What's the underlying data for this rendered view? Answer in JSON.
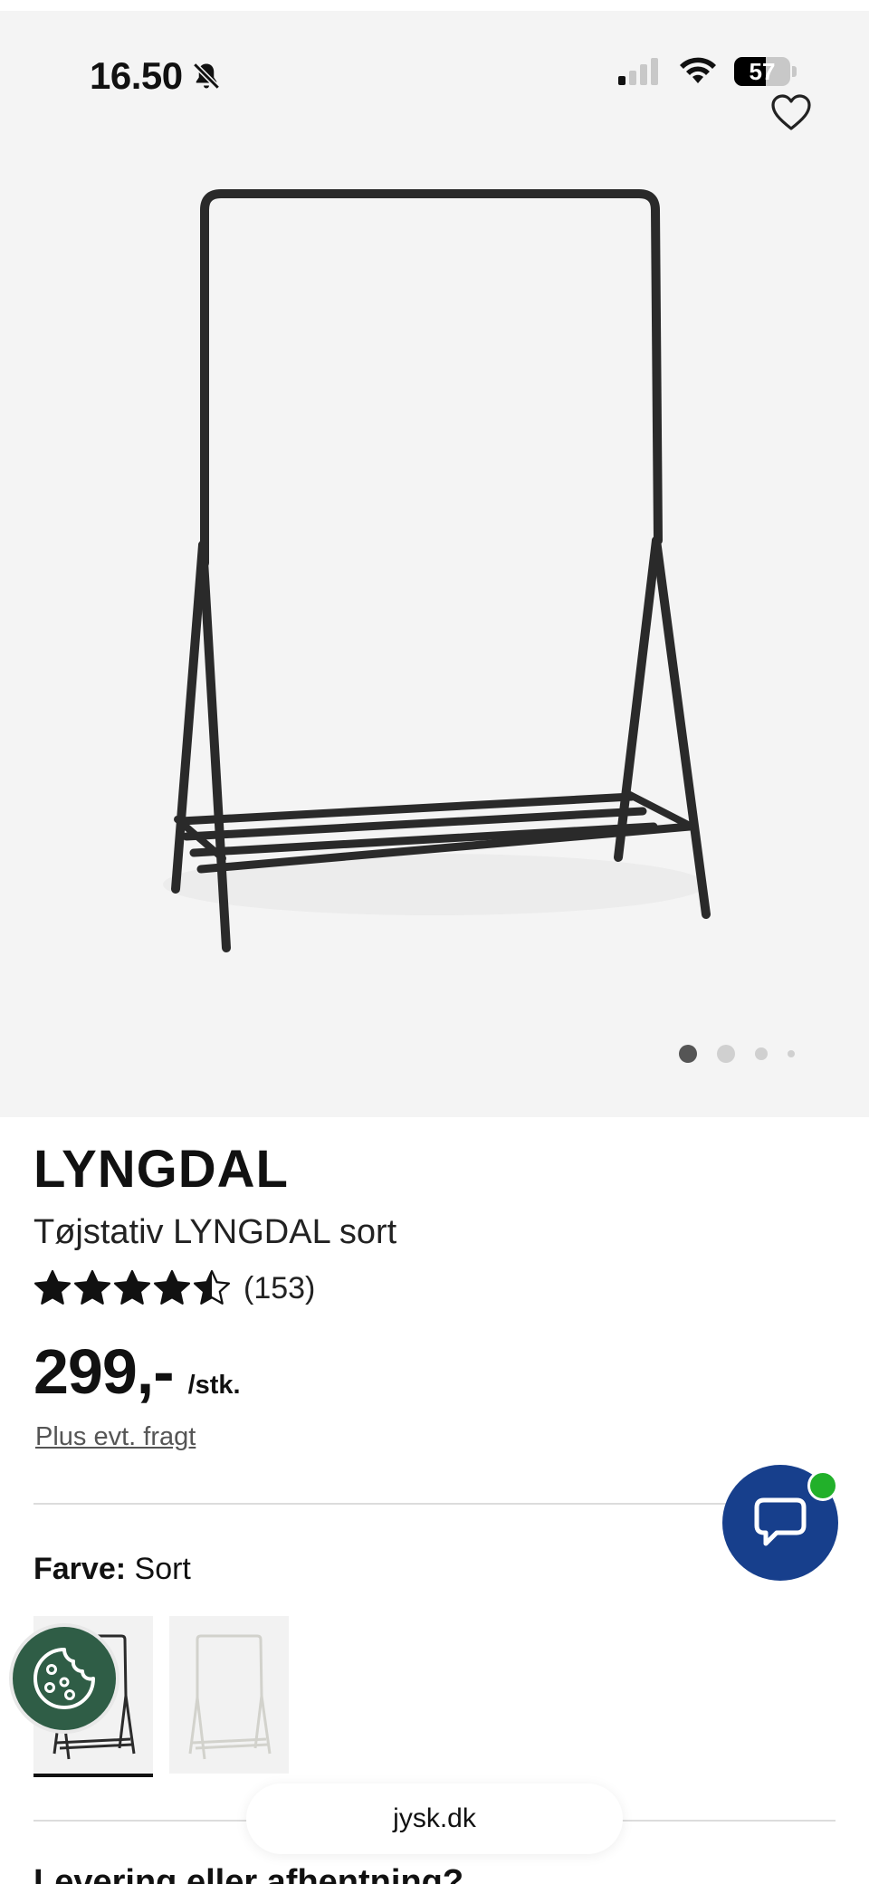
{
  "status_bar": {
    "time": "16.50",
    "battery": "57",
    "battery_level": 0.57,
    "icons": [
      "bell-muted-icon",
      "cellular-signal-icon",
      "wifi-icon",
      "battery-icon"
    ]
  },
  "gallery": {
    "image_count": 4,
    "active_index": 0,
    "favorite_icon": "heart-outline-icon",
    "image_subject": "black clothes rack with shelf"
  },
  "product": {
    "brand": "LYNGDAL",
    "name": "Tøjstativ LYNGDAL sort",
    "rating": 4.5,
    "rating_max": 5,
    "review_count": "(153)",
    "price": "299,-",
    "price_unit": "/stk.",
    "shipping_note": "Plus evt. fragt"
  },
  "color_selector": {
    "label": "Farve:",
    "value": "Sort",
    "options": [
      {
        "name": "sort",
        "selected": true,
        "color": "#2b2b2b"
      },
      {
        "name": "hvid",
        "selected": false,
        "color": "#dcdcd6"
      }
    ]
  },
  "chat": {
    "icon": "chat-bubble-icon",
    "online": true,
    "color": "#173f8c",
    "status_color": "#22b02a"
  },
  "cookie": {
    "icon": "cookie-icon",
    "color": "#2f5d46"
  },
  "browser": {
    "url": "jysk.dk"
  },
  "section": {
    "next_heading": "Levering eller afhentning?"
  }
}
